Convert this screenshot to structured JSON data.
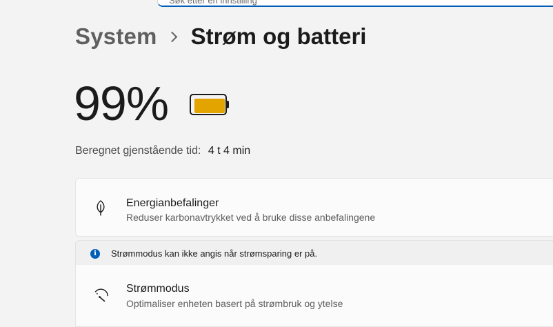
{
  "search": {
    "placeholder_partial": "Søk etter en innstilling"
  },
  "breadcrumb": {
    "parent": "System",
    "current": "Strøm og batteri"
  },
  "battery": {
    "percent_text": "99%",
    "level": 0.99,
    "fill_color": "#e3a400",
    "remaining_label": "Beregnet gjenstående tid:",
    "remaining_value": "4 t 4 min"
  },
  "cards": {
    "energy": {
      "icon": "leaf-icon",
      "title": "Energianbefalinger",
      "subtitle": "Reduser karbonavtrykket ved å bruke disse anbefalingene"
    },
    "info": {
      "icon": "info-icon",
      "text": "Strømmodus kan ikke angis når strømsparing er på."
    },
    "power_mode": {
      "icon": "gauge-icon",
      "title": "Strømmodus",
      "subtitle": "Optimaliser enheten basert på strømbruk og ytelse"
    }
  },
  "colors": {
    "accent": "#005fb8",
    "battery_fill": "#e3a400",
    "background": "#f3f3f3"
  }
}
